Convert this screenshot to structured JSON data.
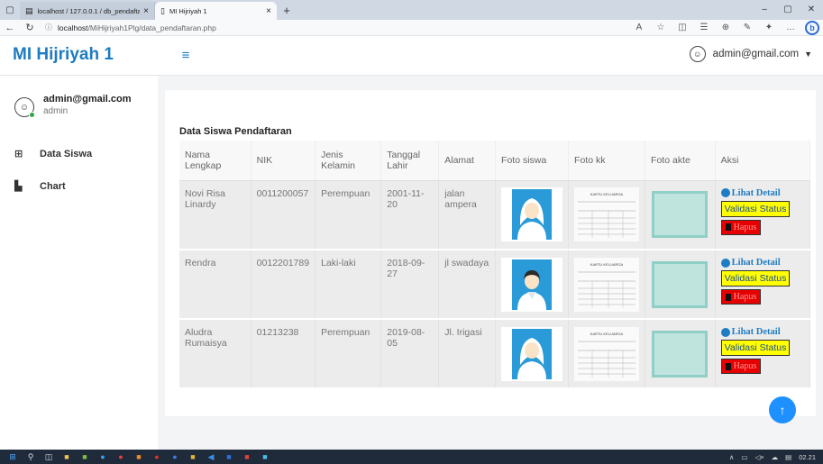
{
  "browser": {
    "tabs": [
      {
        "title": "localhost / 127.0.0.1 / db_pendaftar",
        "close": "×"
      },
      {
        "title": "MI Hijriyah 1",
        "close": "×"
      }
    ],
    "new_tab": "+",
    "url_host": "localhost",
    "url_path": "/MiHijriyah1Plg/data_pendaftaran.php",
    "profile_letter": "b",
    "window_controls": [
      "–",
      "▢",
      "✕"
    ]
  },
  "app": {
    "brand": "MI Hijriyah 1",
    "user_email": "admin@gmail.com"
  },
  "sidebar": {
    "email": "admin@gmail.com",
    "role": "admin",
    "items": [
      {
        "label": "Data Siswa",
        "icon": "table-icon"
      },
      {
        "label": "Chart",
        "icon": "chart-icon"
      }
    ]
  },
  "main": {
    "title": "Data Siswa Pendaftaran",
    "columns": [
      "Nama Lengkap",
      "NIK",
      "Jenis Kelamin",
      "Tanggal Lahir",
      "Alamat",
      "Foto siswa",
      "Foto kk",
      "Foto akte",
      "Aksi"
    ],
    "rows": [
      {
        "nama": "Novi Risa Linardy",
        "nik": "0011200057",
        "jk": "Perempuan",
        "tgl": "2001-11-20",
        "alamat": "jalan ampera",
        "foto": "female"
      },
      {
        "nama": "Rendra",
        "nik": "0012201789",
        "jk": "Laki-laki",
        "tgl": "2018-09-27",
        "alamat": "jl swadaya",
        "foto": "male"
      },
      {
        "nama": "Aludra Rumaisya",
        "nik": "01213238",
        "jk": "Perempuan",
        "tgl": "2019-08-05",
        "alamat": "Jl. Irigasi",
        "foto": "female"
      }
    ],
    "actions": {
      "detail": "Lihat Detail",
      "validasi": "Validasi Status",
      "hapus": "Hapus"
    },
    "kk_header": "KARTU KELUARGA"
  },
  "taskbar": {
    "time": "02.21"
  },
  "colors": {
    "brand": "#1e7cc3",
    "validasi_bg": "#ffff00",
    "hapus_bg": "#e60000",
    "scroll_top": "#1e90ff"
  }
}
